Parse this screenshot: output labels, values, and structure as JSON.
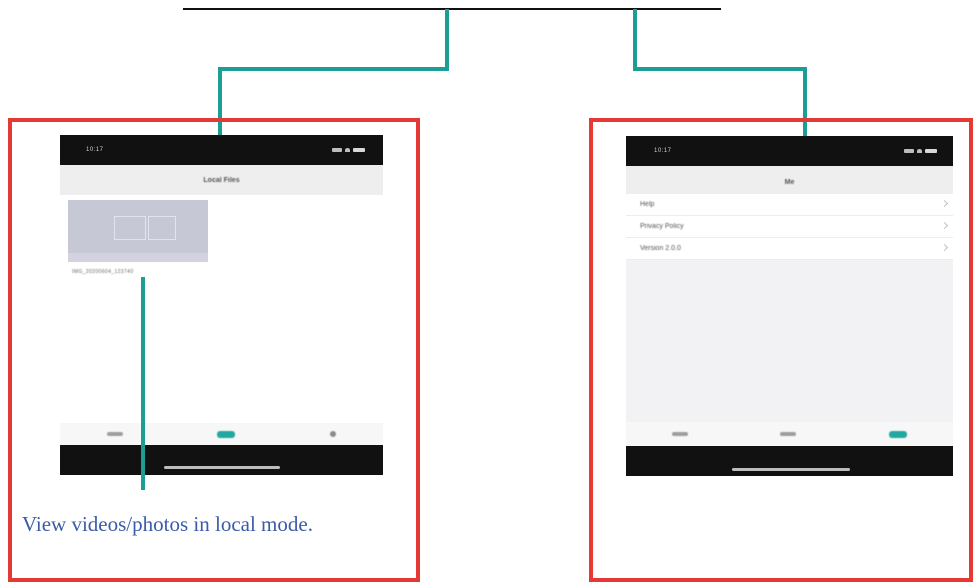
{
  "colors": {
    "frame": "#e53935",
    "connector": "#1a9e96",
    "caption": "#3a5ba8",
    "active_tab": "#22a8a0"
  },
  "left_phone": {
    "status_time": "10:17",
    "title": "Local Files",
    "file_name": "IMG_20200604_123740",
    "tabs": [
      {
        "name": "list-icon",
        "active": false
      },
      {
        "name": "photo-icon",
        "active": true
      },
      {
        "name": "add-icon",
        "active": false
      }
    ]
  },
  "right_phone": {
    "status_time": "10:17",
    "title": "Me",
    "menu": [
      {
        "label": "Help"
      },
      {
        "label": "Privacy Policy"
      },
      {
        "label": "Version 2.0.0"
      }
    ],
    "tabs": [
      {
        "name": "list-icon",
        "active": false
      },
      {
        "name": "photo-icon",
        "active": false
      },
      {
        "name": "me-icon",
        "active": true
      }
    ]
  },
  "caption": "View videos/photos in local mode."
}
